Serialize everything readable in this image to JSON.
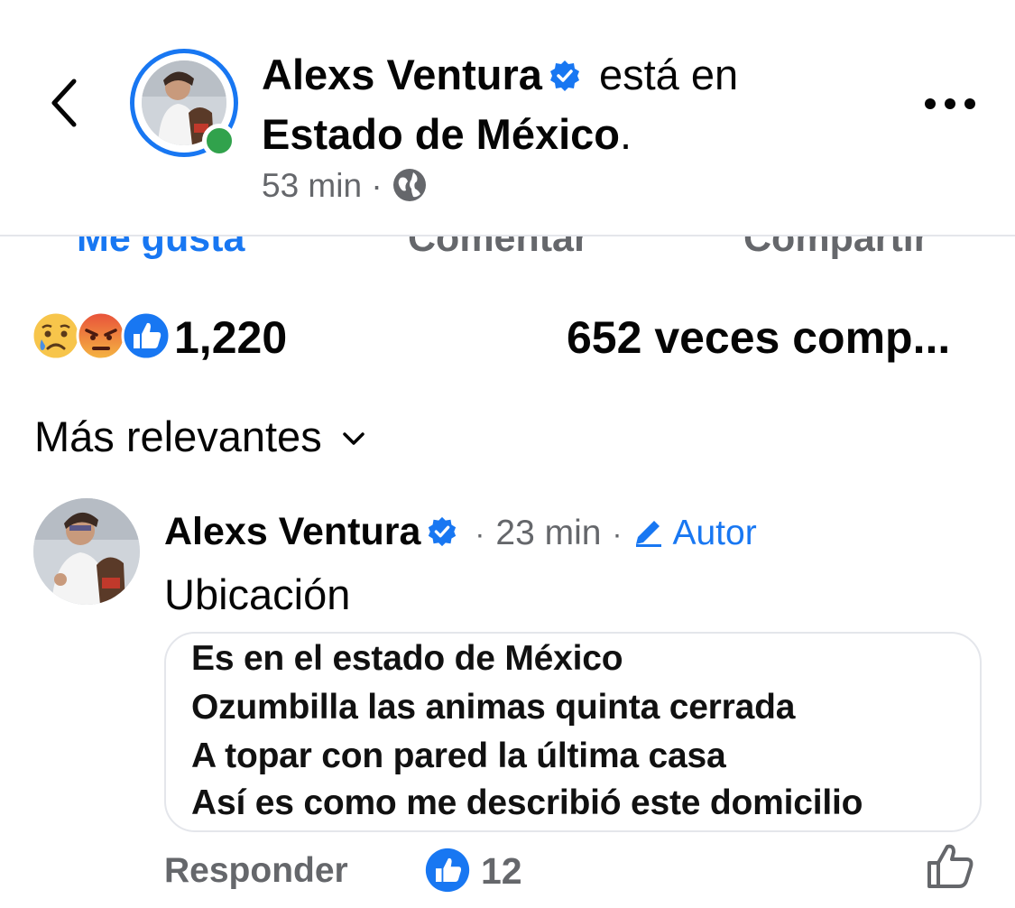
{
  "post": {
    "author": "Alexs Ventura",
    "status_text": "está en",
    "location": "Estado de México",
    "location_suffix": ".",
    "time": "53 min",
    "meta_separator": "·"
  },
  "actions": {
    "like": "Me gusta",
    "comment": "Comentar",
    "share": "Compartir"
  },
  "stats": {
    "reaction_count": "1,220",
    "shares": "652 veces comp..."
  },
  "sort": {
    "label": "Más relevantes"
  },
  "comment": {
    "author": "Alexs Ventura",
    "separator": "·",
    "time": "23 min",
    "badge": "Autor",
    "text": "Ubicación",
    "quote_lines": [
      "Es en el estado de México",
      "Ozumbilla las animas quinta cerrada",
      "A topar con pared la última casa",
      "Así es como me describió este domicilio"
    ],
    "reply_label": "Responder",
    "like_count": "12"
  },
  "colors": {
    "accent": "#1877f2",
    "online": "#31a24c",
    "secondary_text": "#65676b"
  },
  "icons": [
    "back-arrow-icon",
    "verified-badge-icon",
    "globe-icon",
    "more-options-icon",
    "sad-reaction-icon",
    "angry-reaction-icon",
    "like-reaction-icon",
    "chevron-down-icon",
    "pencil-icon",
    "like-outline-icon"
  ]
}
